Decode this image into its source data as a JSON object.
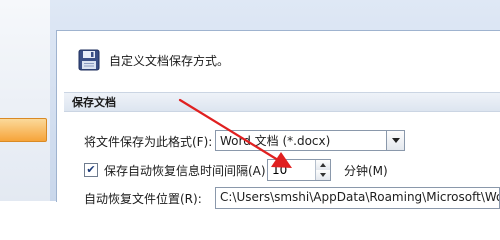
{
  "header": {
    "description": "自定义文档保存方式。",
    "icon": "floppy-disk-icon"
  },
  "section": {
    "title": "保存文档"
  },
  "save_format": {
    "label": "将文件保存为此格式(F):",
    "selected": "Word 文档 (*.docx)"
  },
  "autosave": {
    "label": "保存自动恢复信息时间间隔(A)",
    "checked": true,
    "value": "10",
    "unit": "分钟(M)"
  },
  "autorecover_location": {
    "label": "自动恢复文件位置(R):",
    "value": "C:\\Users\\smshi\\AppData\\Roaming\\Microsoft\\Word"
  },
  "annotation": {
    "type": "red-arrow",
    "color": "#e02020",
    "points_to": "autosave-interval-spinner"
  },
  "colors": {
    "selected_nav": "#f6a43a",
    "frame": "#c9d7eb",
    "section_header": "#dde5f0"
  }
}
